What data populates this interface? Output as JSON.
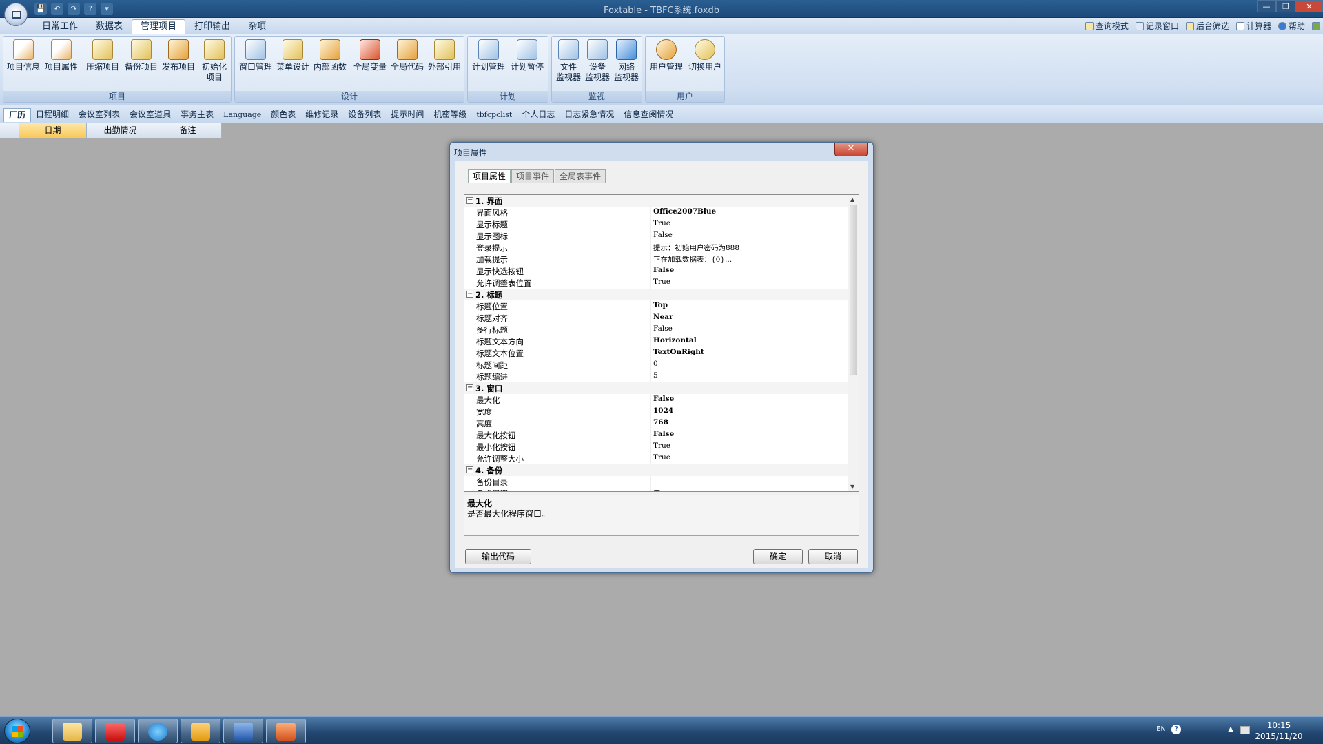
{
  "window": {
    "title": "Foxtable - TBFC系统.foxdb"
  },
  "qat": {
    "buttons": [
      "💾",
      "↶",
      "↷",
      "?",
      "▾"
    ]
  },
  "menubar": {
    "tabs": [
      "日常工作",
      "数据表",
      "管理项目",
      "打印输出",
      "杂项"
    ],
    "active": "管理项目",
    "right_tools": [
      "查询模式",
      "记录窗口",
      "后台筛选",
      "计算器",
      "帮助"
    ]
  },
  "ribbon": {
    "groups": [
      {
        "label": "项目",
        "buttons": [
          "项目信息",
          "项目属性",
          "压缩项目",
          "备份项目",
          "发布项目",
          "初始化\n项目"
        ]
      },
      {
        "label": "设计",
        "buttons": [
          "窗口管理",
          "菜单设计",
          "内部函数",
          "全局变量",
          "全局代码",
          "外部引用"
        ]
      },
      {
        "label": "计划",
        "buttons": [
          "计划管理",
          "计划暂停"
        ]
      },
      {
        "label": "监视",
        "buttons": [
          "文件\n监视器",
          "设备\n监视器",
          "网络\n监视器"
        ]
      },
      {
        "label": "用户",
        "buttons": [
          "用户管理",
          "切换用户"
        ]
      }
    ]
  },
  "sheet_tabs": [
    "厂历",
    "日程明细",
    "会议室列表",
    "会议室道具",
    "事务主表",
    "Language",
    "颜色表",
    "维修记录",
    "设备列表",
    "提示时间",
    "机密等级",
    "tbfcpclist",
    "个人日志",
    "日志紧急情况",
    "信息查阅情况"
  ],
  "grid_columns": [
    "日期",
    "出勤情况",
    "备注"
  ],
  "dialog": {
    "title": "项目属性",
    "close": "✕",
    "tabs": [
      "项目属性",
      "项目事件",
      "全局表事件"
    ],
    "categories": [
      {
        "name": "1. 界面",
        "props": [
          {
            "name": "界面风格",
            "value": "Office2007Blue",
            "bold": true
          },
          {
            "name": "显示标题",
            "value": "True",
            "bold": false
          },
          {
            "name": "显示图标",
            "value": "False",
            "bold": false
          },
          {
            "name": "登录提示",
            "value": "提示：初始用户密码为888",
            "bold": false
          },
          {
            "name": "加载提示",
            "value": "正在加载数据表：{0}...",
            "bold": false
          },
          {
            "name": "显示快选按钮",
            "value": "False",
            "bold": true
          },
          {
            "name": "允许调整表位置",
            "value": "True",
            "bold": false
          }
        ]
      },
      {
        "name": "2. 标题",
        "props": [
          {
            "name": "标题位置",
            "value": "Top",
            "bold": true
          },
          {
            "name": "标题对齐",
            "value": "Near",
            "bold": true
          },
          {
            "name": "多行标题",
            "value": "False",
            "bold": false
          },
          {
            "name": "标题文本方向",
            "value": "Horizontal",
            "bold": true
          },
          {
            "name": "标题文本位置",
            "value": "TextOnRight",
            "bold": true
          },
          {
            "name": "标题间距",
            "value": "0",
            "bold": false
          },
          {
            "name": "标题缩进",
            "value": "5",
            "bold": false
          }
        ]
      },
      {
        "name": "3. 窗口",
        "props": [
          {
            "name": "最大化",
            "value": "False",
            "bold": true
          },
          {
            "name": "宽度",
            "value": "1024",
            "bold": true
          },
          {
            "name": "高度",
            "value": "768",
            "bold": true
          },
          {
            "name": "最大化按钮",
            "value": "False",
            "bold": true
          },
          {
            "name": "最小化按钮",
            "value": "True",
            "bold": false
          },
          {
            "name": "允许调整大小",
            "value": "True",
            "bold": false
          }
        ]
      },
      {
        "name": "4. 备份",
        "props": [
          {
            "name": "备份目录",
            "value": "",
            "bold": false
          },
          {
            "name": "备份周期",
            "value": "无",
            "bold": false
          }
        ]
      }
    ],
    "help": {
      "title": "最大化",
      "desc": "是否最大化程序窗口。"
    },
    "buttons": {
      "export": "输出代码",
      "ok": "确定",
      "cancel": "取消"
    }
  },
  "taskbar": {
    "apps": [
      "explorer",
      "foxtable",
      "ie",
      "outlook",
      "word",
      "app"
    ],
    "lang": "EN",
    "time": "10:15",
    "date": "2015/11/20"
  }
}
